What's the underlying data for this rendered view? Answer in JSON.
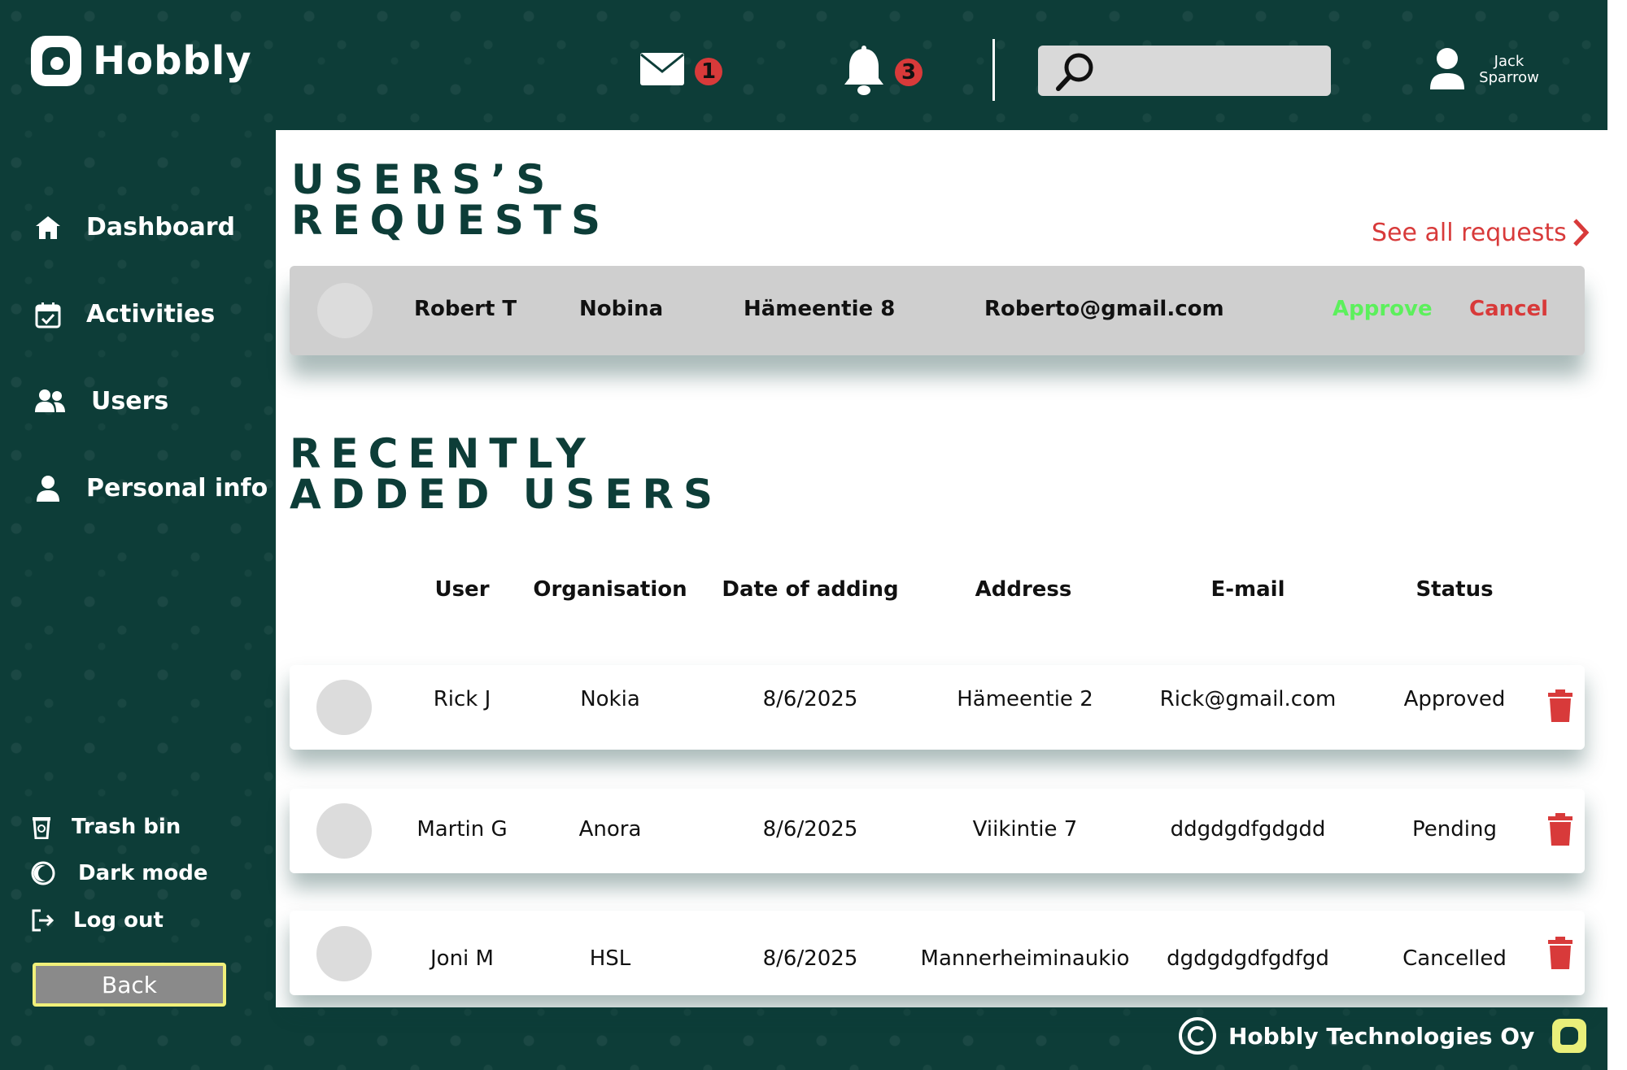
{
  "app": {
    "name": "Hobbly"
  },
  "header": {
    "mail_count": "1",
    "notification_count": "3",
    "search": {
      "placeholder": "",
      "value": ""
    },
    "user": {
      "first_name": "Jack",
      "last_name": "Sparrow"
    }
  },
  "sidebar": {
    "items": [
      {
        "label": "Dashboard",
        "icon": "home-icon"
      },
      {
        "label": "Activities",
        "icon": "calendar-icon"
      },
      {
        "label": "Users",
        "icon": "users-icon"
      },
      {
        "label": "Personal info",
        "icon": "person-icon"
      }
    ],
    "bottom": [
      {
        "label": "Trash bin",
        "icon": "trash-bin-icon"
      },
      {
        "label": "Dark mode",
        "icon": "moon-icon"
      },
      {
        "label": "Log out",
        "icon": "logout-icon"
      }
    ],
    "back_label": "Back"
  },
  "requests": {
    "title_line1": "USERS’S",
    "title_line2": "REQUESTS",
    "see_all": "See all requests",
    "items": [
      {
        "name": "Robert T",
        "organisation": "Nobina",
        "address": "Hämeentie 8",
        "email": "Roberto@gmail.com",
        "approve": "Approve",
        "cancel": "Cancel"
      }
    ]
  },
  "recent": {
    "title_line1": "RECENTLY",
    "title_line2": "ADDED USERS",
    "columns": [
      "User",
      "Organisation",
      "Date of adding",
      "Address",
      "E-mail",
      "Status"
    ],
    "rows": [
      {
        "user": "Rick J",
        "organisation": "Nokia",
        "date": "8/6/2025",
        "address": "Hämeentie 2",
        "email": "Rick@gmail.com",
        "status": "Approved"
      },
      {
        "user": "Martin G",
        "organisation": "Anora",
        "date": "8/6/2025",
        "address": "Viikintie 7",
        "email": "ddgdgdfgdgdd",
        "status": "Pending"
      },
      {
        "user": "Joni M",
        "organisation": "HSL",
        "date": "8/6/2025",
        "address": "Mannerheiminaukio",
        "email": "dgdgdgdfgdfgd",
        "status": "Cancelled"
      }
    ]
  },
  "footer": {
    "company": "Hobbly Technologies Oy"
  },
  "colors": {
    "brand": "#0d3d38",
    "accent_red": "#d83a3a",
    "approve_green": "#5cf05c",
    "back_border": "#f0f07a"
  }
}
